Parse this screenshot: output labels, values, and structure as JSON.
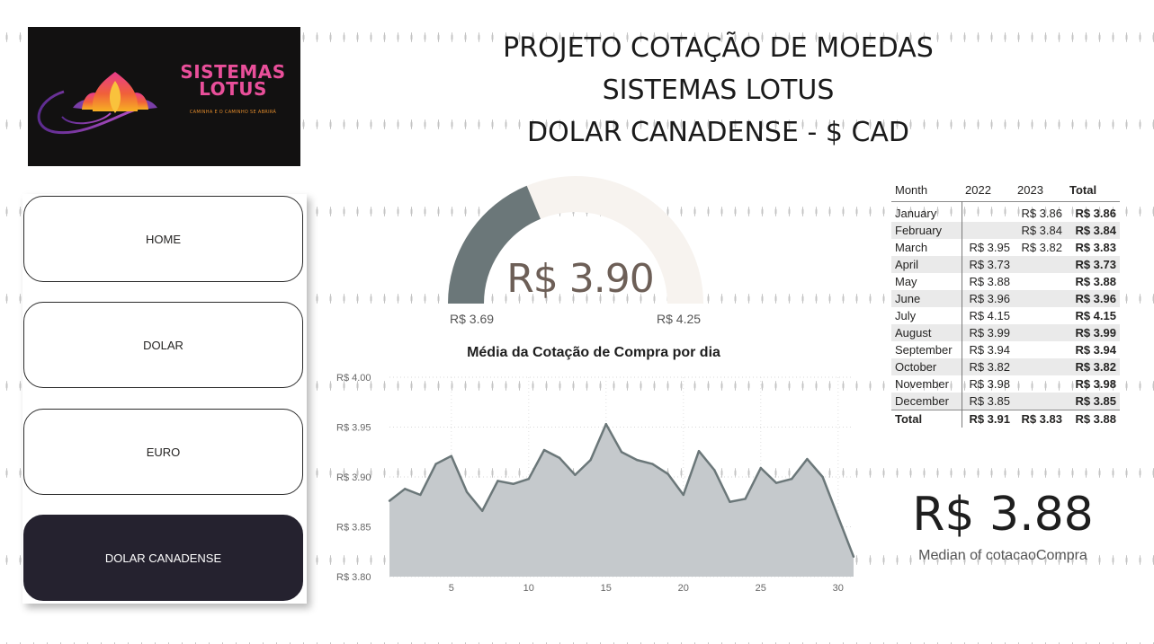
{
  "logo": {
    "title_line1": "SISTEMAS",
    "title_line2": "LOTUS",
    "tagline": "CAMINHA E O CAMINHO SE ABRIRÁ"
  },
  "header": {
    "line1": "PROJETO COTAÇÃO DE MOEDAS",
    "line2": "SISTEMAS LOTUS",
    "line3": "DOLAR CANADENSE - $ CAD"
  },
  "nav": {
    "items": [
      {
        "label": "HOME",
        "active": false
      },
      {
        "label": "DOLAR",
        "active": false
      },
      {
        "label": "EURO",
        "active": false
      },
      {
        "label": "DOLAR CANADENSE",
        "active": true
      }
    ]
  },
  "gauge": {
    "value": 3.9,
    "min": 3.69,
    "max": 4.25,
    "value_label": "R$ 3.90",
    "min_label": "R$ 3.69",
    "max_label": "R$ 4.25",
    "fill_color": "#6b7779",
    "track_color": "#f7f3ef"
  },
  "chart_title": "Média da Cotação de Compra por dia",
  "chart_data": {
    "type": "area",
    "title": "Média da Cotação de Compra por dia",
    "x": [
      1,
      2,
      3,
      4,
      5,
      6,
      7,
      8,
      9,
      10,
      11,
      12,
      13,
      14,
      15,
      16,
      17,
      18,
      19,
      20,
      21,
      22,
      23,
      24,
      25,
      26,
      27,
      28,
      29,
      30,
      31
    ],
    "y": [
      3.876,
      3.888,
      3.882,
      3.913,
      3.921,
      3.885,
      3.866,
      3.896,
      3.893,
      3.898,
      3.927,
      3.919,
      3.902,
      3.917,
      3.953,
      3.925,
      3.917,
      3.913,
      3.903,
      3.882,
      3.926,
      3.907,
      3.875,
      3.878,
      3.909,
      3.894,
      3.898,
      3.918,
      3.9,
      3.86,
      3.82
    ],
    "ylim": [
      3.8,
      4.0
    ],
    "yticks": [
      3.8,
      3.85,
      3.9,
      3.95,
      4.0
    ],
    "ytick_labels": [
      "R$ 3.80",
      "R$ 3.85",
      "R$ 3.90",
      "R$ 3.95",
      "R$ 4.00"
    ],
    "xticks": [
      5,
      10,
      15,
      20,
      25,
      30
    ],
    "xtick_labels": [
      "5",
      "10",
      "15",
      "20",
      "25",
      "30"
    ],
    "xlim": [
      1,
      31
    ],
    "grid": true,
    "line_color": "#6b7779",
    "fill_color": "#c5c9cc"
  },
  "matrix": {
    "headers": [
      "Month",
      "2022",
      "2023",
      "Total"
    ],
    "rows": [
      [
        "January",
        "",
        "R$ 3.86",
        "R$ 3.86"
      ],
      [
        "February",
        "",
        "R$ 3.84",
        "R$ 3.84"
      ],
      [
        "March",
        "R$ 3.95",
        "R$ 3.82",
        "R$ 3.83"
      ],
      [
        "April",
        "R$ 3.73",
        "",
        "R$ 3.73"
      ],
      [
        "May",
        "R$ 3.88",
        "",
        "R$ 3.88"
      ],
      [
        "June",
        "R$ 3.96",
        "",
        "R$ 3.96"
      ],
      [
        "July",
        "R$ 4.15",
        "",
        "R$ 4.15"
      ],
      [
        "August",
        "R$ 3.99",
        "",
        "R$ 3.99"
      ],
      [
        "September",
        "R$ 3.94",
        "",
        "R$ 3.94"
      ],
      [
        "October",
        "R$ 3.82",
        "",
        "R$ 3.82"
      ],
      [
        "November",
        "R$ 3.98",
        "",
        "R$ 3.98"
      ],
      [
        "December",
        "R$ 3.85",
        "",
        "R$ 3.85"
      ]
    ],
    "total": [
      "Total",
      "R$ 3.91",
      "R$ 3.83",
      "R$ 3.88"
    ]
  },
  "kpi": {
    "value": "R$ 3.88",
    "label": "Median of cotacaoCompra"
  }
}
